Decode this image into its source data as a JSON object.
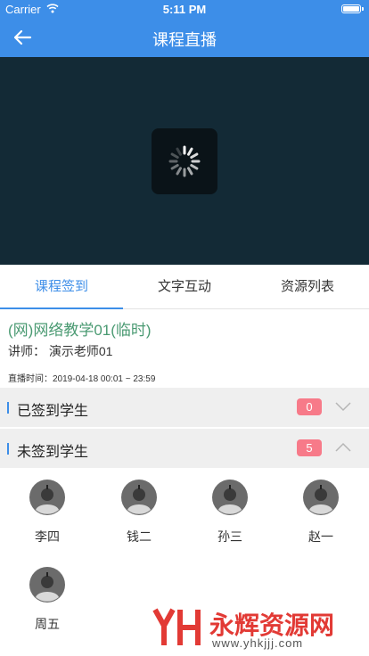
{
  "status_bar": {
    "carrier": "Carrier",
    "time": "5:11 PM"
  },
  "nav": {
    "title": "课程直播"
  },
  "tabs": [
    {
      "label": "课程签到",
      "active": true
    },
    {
      "label": "文字互动",
      "active": false
    },
    {
      "label": "资源列表",
      "active": false
    }
  ],
  "course": {
    "title": "(网)网络教学01(临时)",
    "teacher": "讲师：  演示老师01",
    "live_time": "直播时间：2019-04-18 00:01 ~  23:59"
  },
  "signed_section": {
    "label": "已签到学生",
    "count": "0",
    "expanded": false
  },
  "unsigned_section": {
    "label": "未签到学生",
    "count": "5",
    "expanded": true
  },
  "students": [
    {
      "name": "李四"
    },
    {
      "name": "钱二"
    },
    {
      "name": "孙三"
    },
    {
      "name": "赵一"
    },
    {
      "name": "周五"
    }
  ],
  "watermark": {
    "brand": "永辉资源网",
    "url": "www.yhkjjj.com"
  },
  "colors": {
    "accent": "#3d8ee8",
    "badge": "#f77a89",
    "course_title": "#4a9a72",
    "player_bg": "#132a36"
  }
}
